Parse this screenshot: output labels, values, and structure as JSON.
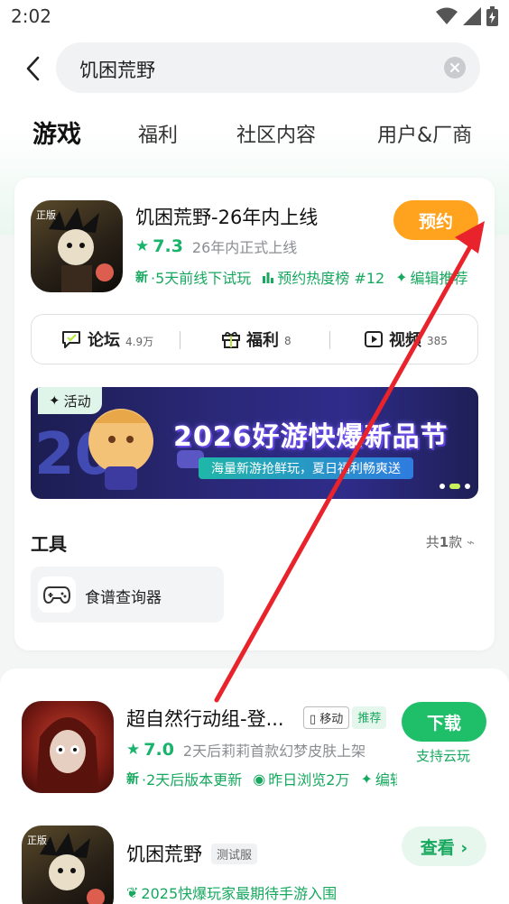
{
  "status_bar": {
    "time": "2:02"
  },
  "search": {
    "query": "饥困荒野"
  },
  "tabs": [
    {
      "label": "游戏",
      "active": true
    },
    {
      "label": "福利"
    },
    {
      "label": "社区内容"
    },
    {
      "label": "用户&厂商"
    }
  ],
  "main_game": {
    "badge": "正版",
    "name": "饥困荒野-26年内上线",
    "score": "7.3",
    "release": "26年内正式上线",
    "tags": [
      {
        "prefix": "新",
        "text": "·5天前线下试玩"
      },
      {
        "prefix": "",
        "text": "预约热度榜 #12"
      },
      {
        "prefix": "",
        "text": "编辑推荐"
      }
    ],
    "reserve_label": "预约",
    "quick_links": [
      {
        "label": "论坛",
        "count": "4.9万"
      },
      {
        "label": "福利",
        "count": "8"
      },
      {
        "label": "视频",
        "count": "385"
      }
    ],
    "banner": {
      "badge": "活动",
      "title": "2026好游快爆新品节",
      "subtitle": "海量新游抢鲜玩，夏日福利畅爽送"
    },
    "tools": {
      "title": "工具",
      "count_prefix": "共",
      "count": "1",
      "count_suffix": "款",
      "items": [
        {
          "label": "食谱查询器"
        }
      ]
    }
  },
  "results": [
    {
      "name": "超自然行动组-登...",
      "platform_chip": "移动",
      "rec_chip": "推荐",
      "score": "7.0",
      "desc": "2天后莉莉首款幻梦皮肤上架",
      "tags": [
        {
          "prefix": "新",
          "text": "·2天后版本更新"
        },
        {
          "prefix": "",
          "text": "昨日浏览2万"
        },
        {
          "prefix": "",
          "text": "编辑推荐"
        }
      ],
      "action": "下载",
      "action_sub": "支持云玩"
    },
    {
      "badge": "正版",
      "name": "饥困荒野",
      "test_chip": "测试服",
      "desc": "2025快爆玩家最期待手游入围",
      "action": "查看 ›"
    }
  ],
  "colors": {
    "accent_green": "#19b36b",
    "reserve_orange": "#ffa21d",
    "annotation_red": "#e8232b"
  }
}
